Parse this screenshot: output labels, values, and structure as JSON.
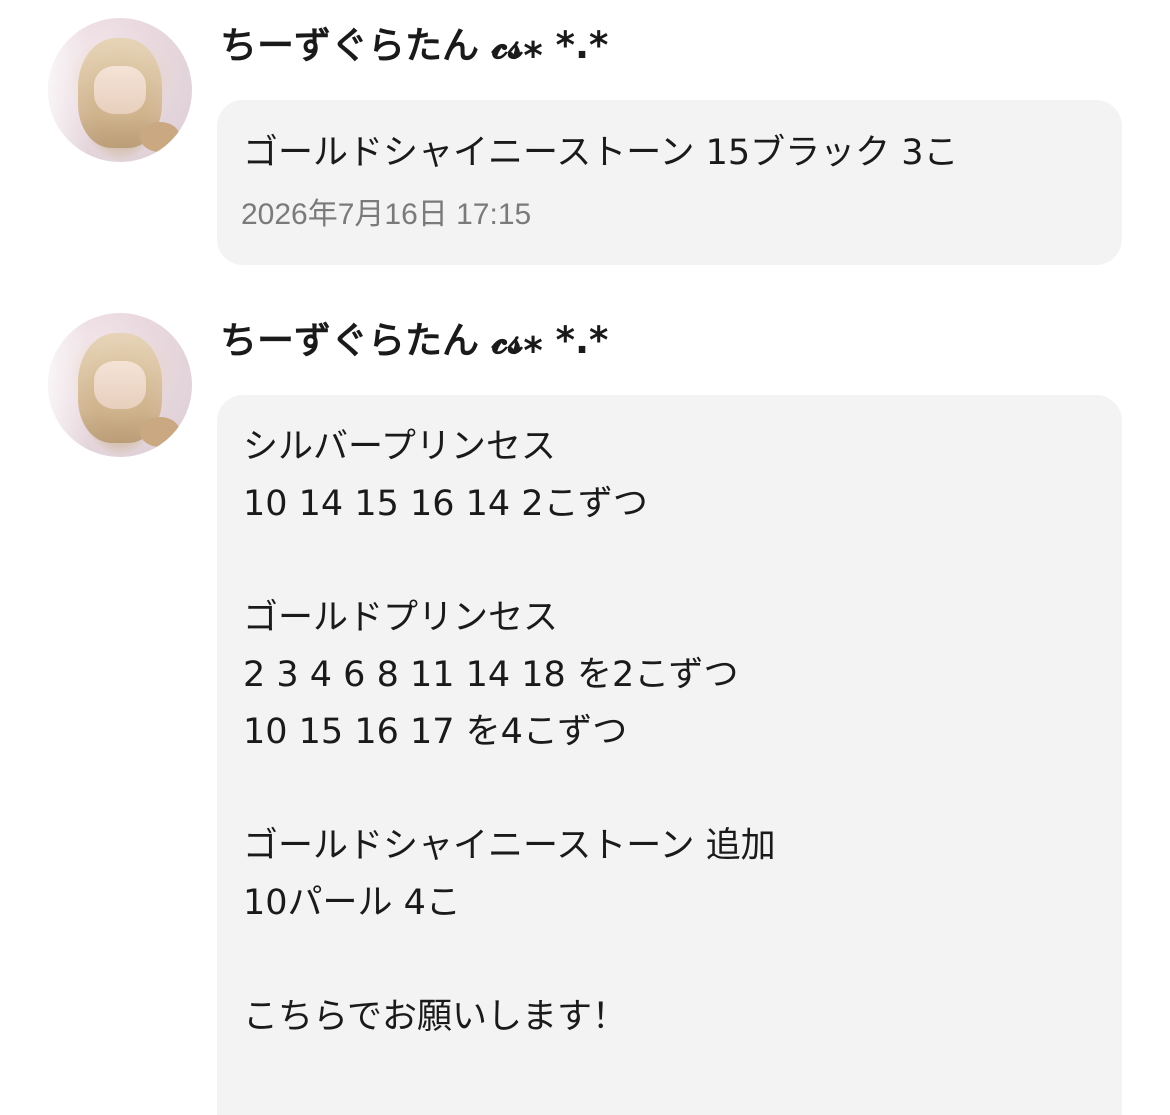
{
  "messages": [
    {
      "username": "ちーずぐらたん 𝓬𝓼⁎ *.*",
      "text": "ゴールドシャイニーストーン 15ブラック 3こ",
      "timestamp": "2026年7月16日 17:15"
    },
    {
      "username": "ちーずぐらたん 𝓬𝓼⁎ *.*",
      "lines": [
        "シルバープリンセス",
        "10 14 15 16 14 2こずつ",
        "",
        "ゴールドプリンセス",
        "2 3 4 6 8 11 14 18 を2こずつ",
        "10 15 16 17 を4こずつ",
        "",
        "ゴールドシャイニーストーン 追加",
        "10パール 4こ",
        "",
        "こちらでお願いします！"
      ]
    }
  ]
}
